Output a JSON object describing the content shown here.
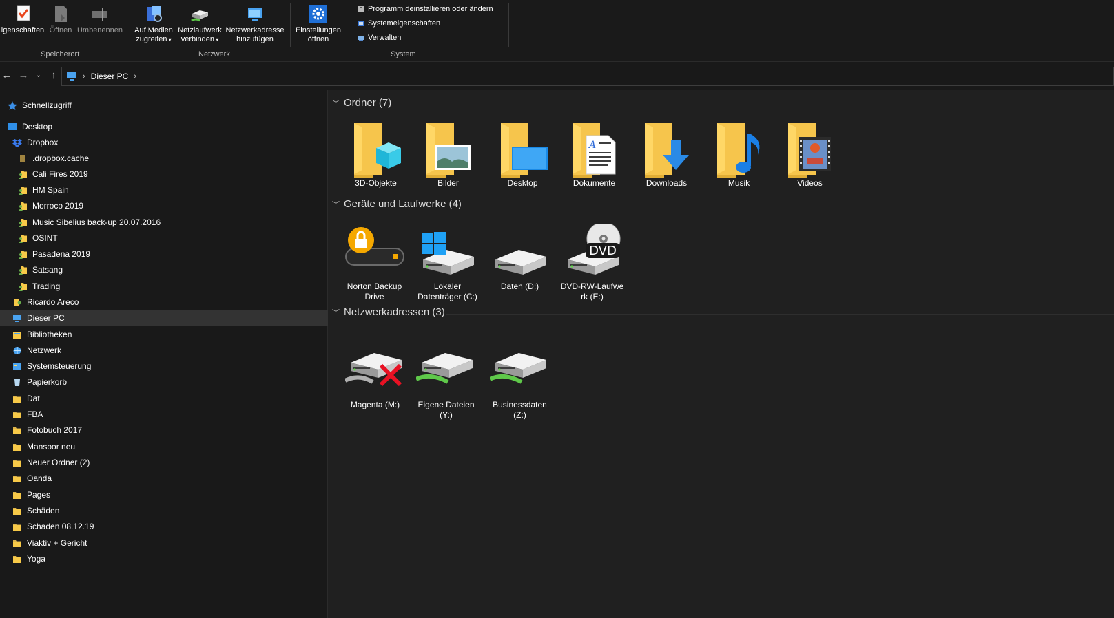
{
  "ribbon": {
    "groups": {
      "location": {
        "label": "Speicherort",
        "properties": "igenschaften",
        "open": "Öffnen",
        "rename": "Umbenennen"
      },
      "network": {
        "label": "Netzwerk",
        "media_l1": "Auf Medien",
        "media_l2": "zugreifen",
        "map_l1": "Netzlaufwerk",
        "map_l2": "verbinden",
        "addloc_l1": "Netzwerkadresse",
        "addloc_l2": "hinzufügen"
      },
      "system": {
        "label": "System",
        "settings_l1": "Einstellungen",
        "settings_l2": "öffnen",
        "uninstall": "Programm deinstallieren oder ändern",
        "sysprops": "Systemeigenschaften",
        "manage": "Verwalten"
      }
    }
  },
  "address": {
    "crumb": "Dieser PC"
  },
  "sidebar": {
    "items": [
      {
        "label": "Schnellzugriff",
        "icon": "star-icon"
      },
      {
        "label": "Desktop",
        "icon": "desktop-icon"
      },
      {
        "label": "Dropbox",
        "icon": "dropbox-icon"
      },
      {
        "label": ".dropbox.cache",
        "icon": "folder-icon"
      },
      {
        "label": "Cali Fires 2019",
        "icon": "shared-folder-icon"
      },
      {
        "label": "HM Spain",
        "icon": "shared-folder-icon"
      },
      {
        "label": "Morroco 2019",
        "icon": "shared-folder-icon"
      },
      {
        "label": "Music Sibelius back-up 20.07.2016",
        "icon": "shared-folder-icon"
      },
      {
        "label": "OSINT",
        "icon": "shared-folder-icon"
      },
      {
        "label": "Pasadena 2019",
        "icon": "shared-folder-icon"
      },
      {
        "label": "Satsang",
        "icon": "shared-folder-icon"
      },
      {
        "label": "Trading",
        "icon": "shared-folder-icon"
      },
      {
        "label": "Ricardo Areco",
        "icon": "user-folder-icon"
      },
      {
        "label": "Dieser PC",
        "icon": "pc-icon"
      },
      {
        "label": "Bibliotheken",
        "icon": "libraries-icon"
      },
      {
        "label": "Netzwerk",
        "icon": "network-icon"
      },
      {
        "label": "Systemsteuerung",
        "icon": "control-panel-icon"
      },
      {
        "label": "Papierkorb",
        "icon": "recycle-bin-icon"
      },
      {
        "label": "Dat",
        "icon": "folder-icon"
      },
      {
        "label": "FBA",
        "icon": "folder-icon"
      },
      {
        "label": "Fotobuch 2017",
        "icon": "folder-icon"
      },
      {
        "label": "Mansoor neu",
        "icon": "folder-icon"
      },
      {
        "label": "Neuer Ordner (2)",
        "icon": "folder-icon"
      },
      {
        "label": "Oanda",
        "icon": "folder-icon"
      },
      {
        "label": "Pages",
        "icon": "folder-icon"
      },
      {
        "label": "Schäden",
        "icon": "folder-icon"
      },
      {
        "label": "Schaden 08.12.19",
        "icon": "folder-icon"
      },
      {
        "label": "Viaktiv + Gericht",
        "icon": "folder-icon"
      },
      {
        "label": "Yoga",
        "icon": "folder-icon"
      }
    ]
  },
  "main": {
    "sections": [
      {
        "title": "Ordner (7)",
        "items": [
          {
            "label": "3D-Objekte",
            "icon": "3d-objects-folder-icon"
          },
          {
            "label": "Bilder",
            "icon": "pictures-folder-icon"
          },
          {
            "label": "Desktop",
            "icon": "desktop-folder-icon"
          },
          {
            "label": "Dokumente",
            "icon": "documents-folder-icon"
          },
          {
            "label": "Downloads",
            "icon": "downloads-folder-icon"
          },
          {
            "label": "Musik",
            "icon": "music-folder-icon"
          },
          {
            "label": "Videos",
            "icon": "videos-folder-icon"
          }
        ]
      },
      {
        "title": "Geräte und Laufwerke (4)",
        "items": [
          {
            "label_l1": "Norton Backup",
            "label_l2": "Drive",
            "icon": "norton-backup-drive-icon"
          },
          {
            "label_l1": "Lokaler",
            "label_l2": "Datenträger (C:)",
            "icon": "windows-drive-icon"
          },
          {
            "label_l1": "Daten (D:)",
            "label_l2": "",
            "icon": "hard-drive-icon"
          },
          {
            "label_l1": "DVD-RW-Laufwe",
            "label_l2": "rk (E:)",
            "icon": "dvd-drive-icon",
            "dvd_text": "DVD"
          }
        ]
      },
      {
        "title": "Netzwerkadressen (3)",
        "items": [
          {
            "label_l1": "Magenta (M:)",
            "label_l2": "",
            "icon": "disconnected-network-drive-icon"
          },
          {
            "label_l1": "Eigene Dateien",
            "label_l2": "(Y:)",
            "icon": "network-drive-icon"
          },
          {
            "label_l1": "Businessdaten",
            "label_l2": "(Z:)",
            "icon": "network-drive-icon"
          }
        ]
      }
    ]
  },
  "colors": {
    "background": "#191919",
    "content_bg": "#202020",
    "selection": "#333333",
    "folder_yellow": "#f7c948",
    "accent_blue": "#1e90ff",
    "error_red": "#e81123",
    "network_green": "#5fc84a"
  }
}
